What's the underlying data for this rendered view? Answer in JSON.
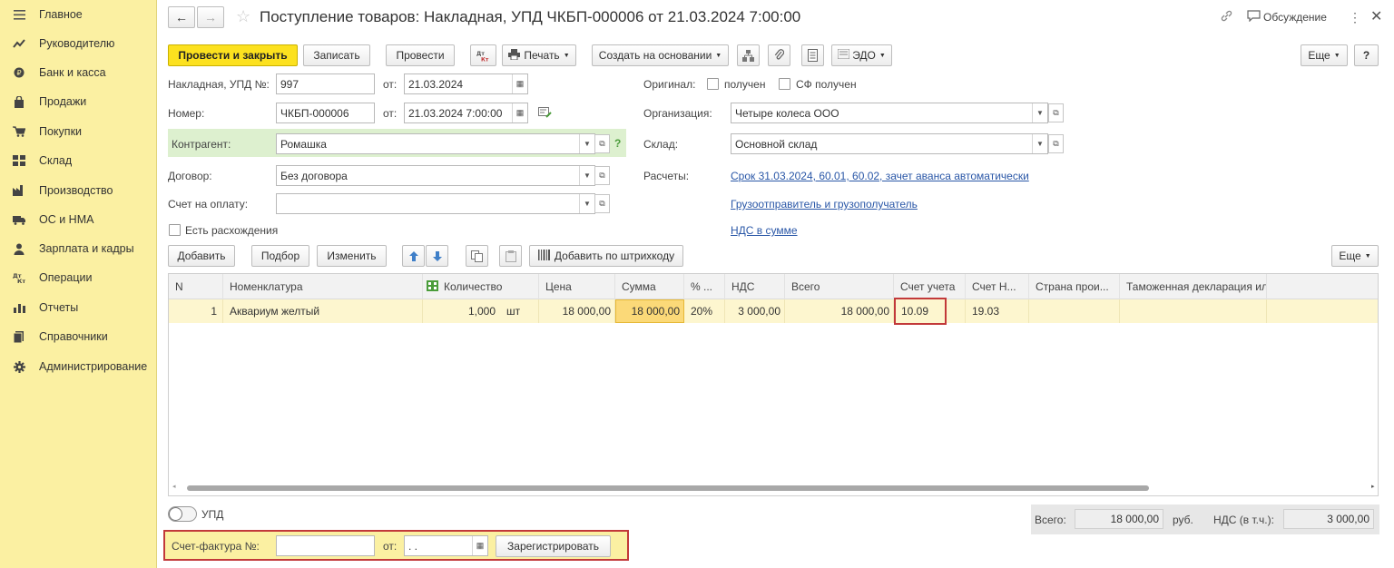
{
  "sidebar": {
    "items": [
      {
        "label": "Главное",
        "icon": "hamburger-icon"
      },
      {
        "label": "Руководителю",
        "icon": "trend-icon"
      },
      {
        "label": "Банк и касса",
        "icon": "coin-icon"
      },
      {
        "label": "Продажи",
        "icon": "bag-icon"
      },
      {
        "label": "Покупки",
        "icon": "cart-icon"
      },
      {
        "label": "Склад",
        "icon": "warehouse-icon"
      },
      {
        "label": "Производство",
        "icon": "factory-icon"
      },
      {
        "label": "ОС и НМА",
        "icon": "truck-icon"
      },
      {
        "label": "Зарплата и кадры",
        "icon": "person-icon"
      },
      {
        "label": "Операции",
        "icon": "dt-kt-icon"
      },
      {
        "label": "Отчеты",
        "icon": "chart-icon"
      },
      {
        "label": "Справочники",
        "icon": "book-icon"
      },
      {
        "label": "Администрирование",
        "icon": "gear-icon"
      }
    ]
  },
  "header": {
    "title": "Поступление товаров: Накладная, УПД ЧКБП-000006 от 21.03.2024 7:00:00",
    "discussion": "Обсуждение"
  },
  "toolbar": {
    "post_close": "Провести и закрыть",
    "save": "Записать",
    "post": "Провести",
    "dtkt": "Дт Кт",
    "print": "Печать",
    "create_based": "Создать на основании",
    "edo": "ЭДО",
    "more": "Еще",
    "help": "?"
  },
  "form": {
    "invoice_label": "Накладная, УПД №:",
    "invoice_value": "997",
    "from_label": "от:",
    "invoice_date": "21.03.2024",
    "number_label": "Номер:",
    "number_value": "ЧКБП-000006",
    "number_date": "21.03.2024  7:00:00",
    "counterparty_label": "Контрагент:",
    "counterparty_value": "Ромашка",
    "contract_label": "Договор:",
    "contract_value": "Без договора",
    "payment_label": "Счет на оплату:",
    "payment_value": "",
    "discrepancy_label": "Есть расхождения",
    "original_label": "Оригинал:",
    "received_label": "получен",
    "sf_received_label": "СФ получен",
    "org_label": "Организация:",
    "org_value": "Четыре колеса ООО",
    "warehouse_label": "Склад:",
    "warehouse_value": "Основной склад",
    "settlements_label": "Расчеты:",
    "settlements_link": "Срок 31.03.2024, 60.01, 60.02, зачет аванса автоматически",
    "shipper_link": "Грузоотправитель и грузополучатель",
    "vat_link": "НДС в сумме"
  },
  "table_toolbar": {
    "add": "Добавить",
    "select": "Подбор",
    "change": "Изменить",
    "barcode": "Добавить по штрихкоду",
    "more": "Еще"
  },
  "table": {
    "headers": [
      "N",
      "Номенклатура",
      "Количество",
      "Цена",
      "Сумма",
      "% ...",
      "НДС",
      "Всего",
      "Счет учета",
      "Счет Н...",
      "Страна прои...",
      "Таможенная декларация или РНПТ"
    ],
    "rows": [
      {
        "n": "1",
        "name": "Аквариум желтый",
        "qty": "1,000",
        "unit": "шт",
        "price": "18 000,00",
        "sum": "18 000,00",
        "vat_rate": "20%",
        "vat": "3 000,00",
        "total": "18 000,00",
        "account": "10.09",
        "vat_account": "19.03",
        "country": "",
        "customs": ""
      }
    ]
  },
  "footer": {
    "upd_label": "УПД",
    "invoice_label": "Счет-фактура №:",
    "invoice_value": "",
    "from_label": "от:",
    "date_value": " .  .",
    "register": "Зарегистрировать",
    "total_label": "Всего:",
    "total_value": "18 000,00",
    "currency": "руб.",
    "vat_label": "НДС (в т.ч.):",
    "vat_value": "3 000,00"
  }
}
